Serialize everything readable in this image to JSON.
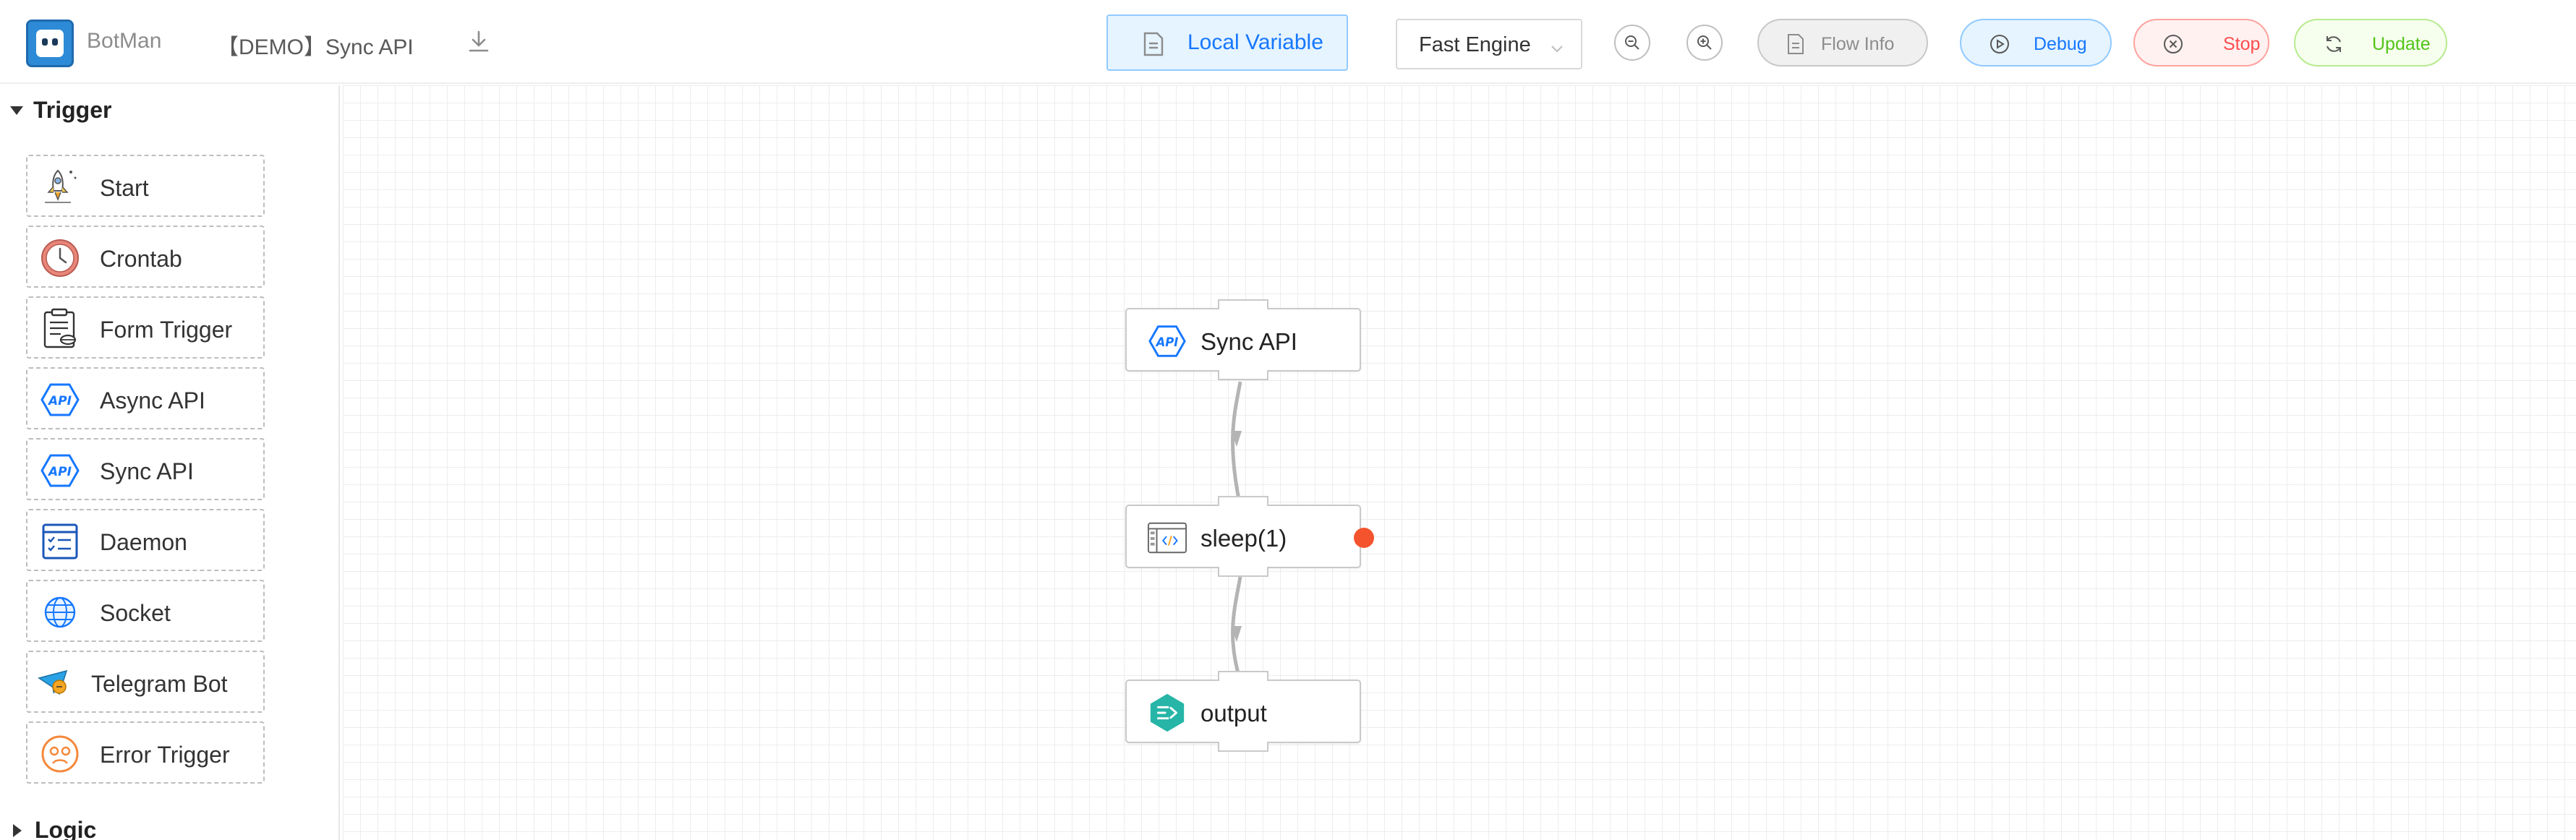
{
  "header": {
    "app_name": "BotMan",
    "flow_title": "【DEMO】Sync API",
    "local_variable_label": "Local Variable",
    "engine_select_value": "Fast Engine",
    "flow_info_label": "Flow Info",
    "debug_label": "Debug",
    "stop_label": "Stop",
    "update_label": "Update"
  },
  "sidebar": {
    "trigger_group": {
      "title": "Trigger",
      "expanded": true,
      "items": [
        {
          "label": "Start",
          "icon": "rocket-icon"
        },
        {
          "label": "Crontab",
          "icon": "clock-icon"
        },
        {
          "label": "Form Trigger",
          "icon": "form-icon"
        },
        {
          "label": "Async API",
          "icon": "api-icon"
        },
        {
          "label": "Sync API",
          "icon": "api-icon"
        },
        {
          "label": "Daemon",
          "icon": "checklist-icon"
        },
        {
          "label": "Socket",
          "icon": "globe-icon"
        },
        {
          "label": "Telegram Bot",
          "icon": "telegram-icon"
        },
        {
          "label": "Error Trigger",
          "icon": "error-face-icon"
        }
      ]
    },
    "logic_group": {
      "title": "Logic",
      "expanded": false
    }
  },
  "canvas": {
    "nodes": [
      {
        "label": "Sync API",
        "icon": "api-icon"
      },
      {
        "label": "sleep(1)",
        "icon": "code-icon",
        "error_port": true
      },
      {
        "label": "output",
        "icon": "output-icon"
      }
    ]
  },
  "colors": {
    "primary": "#1677ff",
    "danger": "#ff4d4f",
    "success": "#52c41a",
    "error_port": "#f5532d",
    "output_icon": "#26b5a7"
  }
}
